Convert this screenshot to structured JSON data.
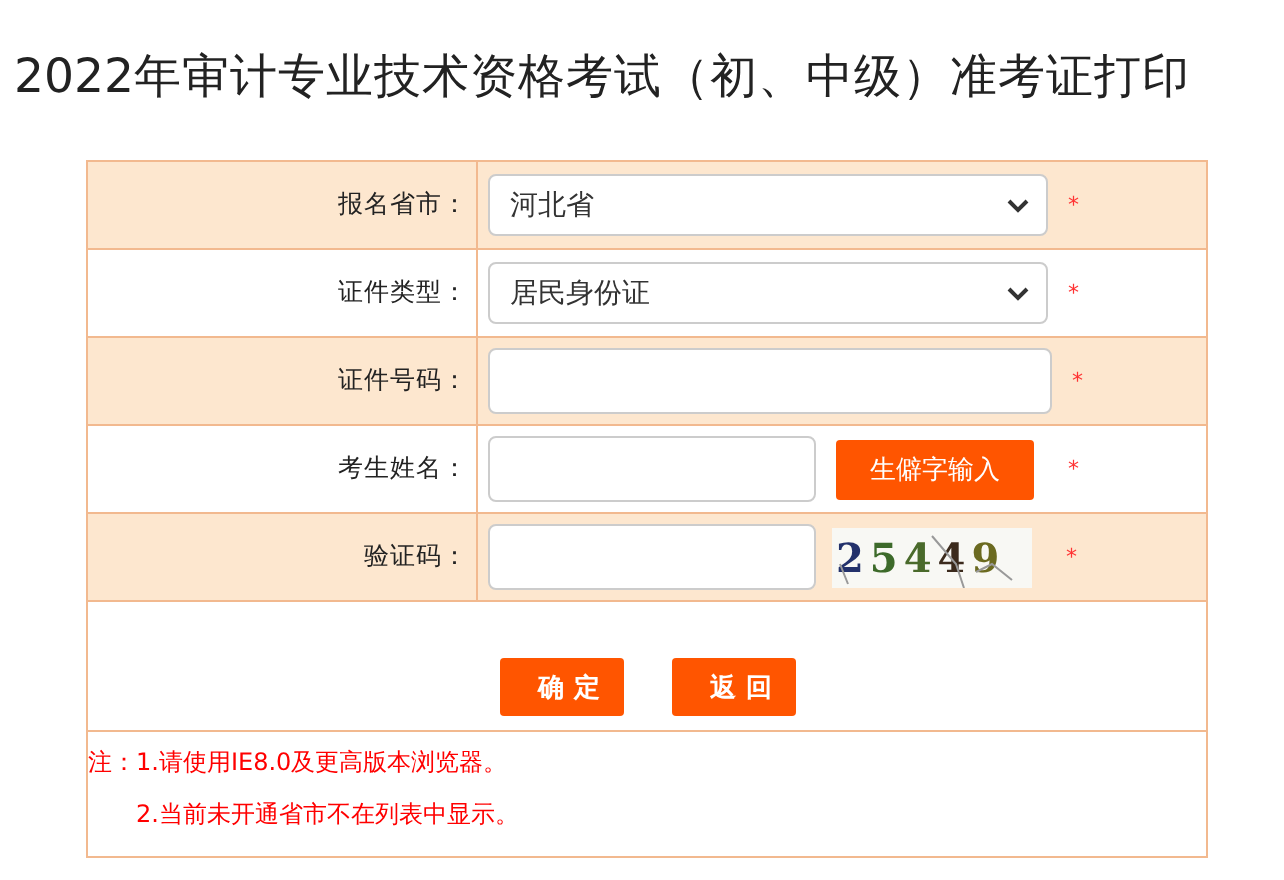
{
  "title": "2022年审计专业技术资格考试（初、中级）准考证打印",
  "form": {
    "rows": [
      {
        "kind": "select",
        "label": "报名省市：",
        "value": "河北省",
        "required_mark": "*"
      },
      {
        "kind": "select",
        "label": "证件类型：",
        "value": "居民身份证",
        "required_mark": "*"
      },
      {
        "kind": "input",
        "label": "证件号码：",
        "required_mark": "*"
      },
      {
        "kind": "input-button",
        "label": "考生姓名：",
        "button": "生僻字输入",
        "required_mark": "*"
      },
      {
        "kind": "captcha",
        "label": "验证码：",
        "captcha": "25449",
        "required_mark": "*"
      }
    ],
    "buttons": [
      "确 定",
      "返 回"
    ],
    "notes": [
      "注：1.请使用IE8.0及更高版本浏览器。",
      "2.当前未开通省市不在列表中显示。"
    ]
  }
}
